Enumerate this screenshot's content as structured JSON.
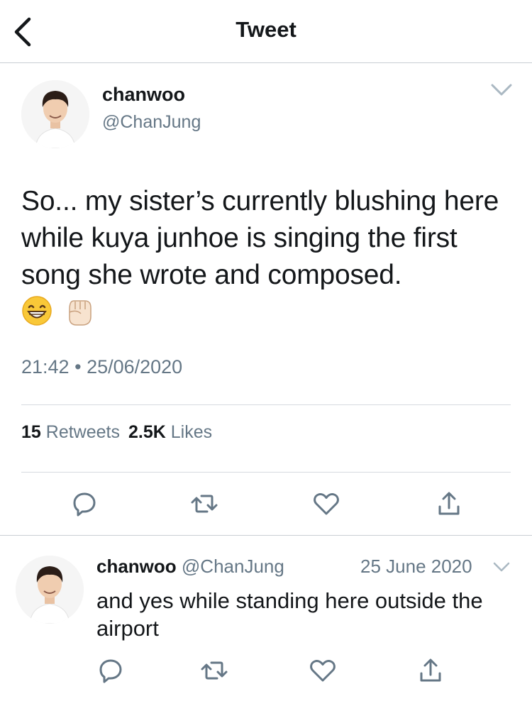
{
  "header": {
    "title": "Tweet",
    "back_icon": "chevron-left-icon"
  },
  "tweet": {
    "author_name": "chanwoo",
    "author_handle": "@ChanJung",
    "text": "So... my sister’s currently blushing here while kuya junhoe is singing the first song she wrote and composed.",
    "emojis": [
      "grinning-face-emoji",
      "raised-fist-emoji"
    ],
    "time": "21:42",
    "separator": "•",
    "date": "25/06/2020",
    "retweets_count": "15",
    "retweets_label": "Retweets",
    "likes_count": "2.5K",
    "likes_label": "Likes",
    "actions": [
      "reply-icon",
      "retweet-icon",
      "like-icon",
      "share-icon"
    ]
  },
  "reply": {
    "author_name": "chanwoo",
    "author_handle": "@ChanJung",
    "date": "25 June 2020",
    "text": "and yes while standing here outside the airport",
    "actions": [
      "reply-icon",
      "retweet-icon",
      "like-icon",
      "share-icon"
    ]
  },
  "colors": {
    "text_primary": "#14171a",
    "text_secondary": "#657786",
    "icon": "#657786",
    "divider": "#d6dbe0"
  }
}
